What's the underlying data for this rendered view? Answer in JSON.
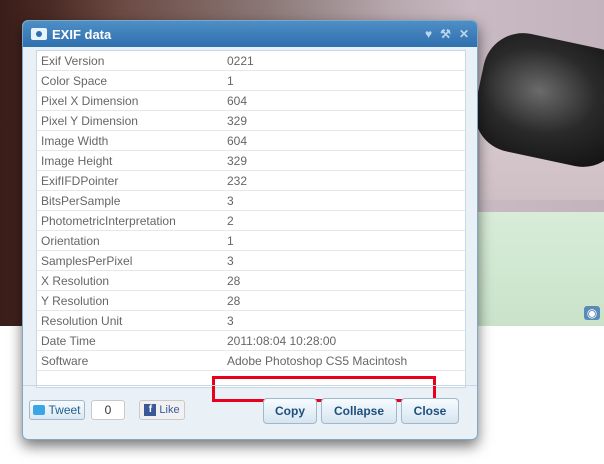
{
  "dialog": {
    "title": "EXIF data",
    "icons": [
      "camera-icon",
      "heart-icon",
      "wrench-icon",
      "close-icon"
    ]
  },
  "exif": [
    {
      "key": "Exif Version",
      "value": "0221"
    },
    {
      "key": "Color Space",
      "value": "1"
    },
    {
      "key": "Pixel X Dimension",
      "value": "604"
    },
    {
      "key": "Pixel Y Dimension",
      "value": "329"
    },
    {
      "key": "Image Width",
      "value": "604"
    },
    {
      "key": "Image Height",
      "value": "329"
    },
    {
      "key": "ExifIFDPointer",
      "value": "232"
    },
    {
      "key": "BitsPerSample",
      "value": "3"
    },
    {
      "key": "PhotometricInterpretation",
      "value": "2"
    },
    {
      "key": "Orientation",
      "value": "1"
    },
    {
      "key": "SamplesPerPixel",
      "value": "3"
    },
    {
      "key": "X Resolution",
      "value": "28"
    },
    {
      "key": "Y Resolution",
      "value": "28"
    },
    {
      "key": "Resolution Unit",
      "value": "3"
    },
    {
      "key": "Date Time",
      "value": "2011:08:04 10:28:00"
    },
    {
      "key": "Software",
      "value": "Adobe Photoshop CS5 Macintosh"
    }
  ],
  "footer": {
    "tweet_label": "Tweet",
    "tweet_count": "0",
    "like_label": "Like",
    "copy_label": "Copy",
    "collapse_label": "Collapse",
    "close_label": "Close"
  },
  "colors": {
    "title_bar": "#2e6fae",
    "highlight_box": "#e8001c"
  }
}
